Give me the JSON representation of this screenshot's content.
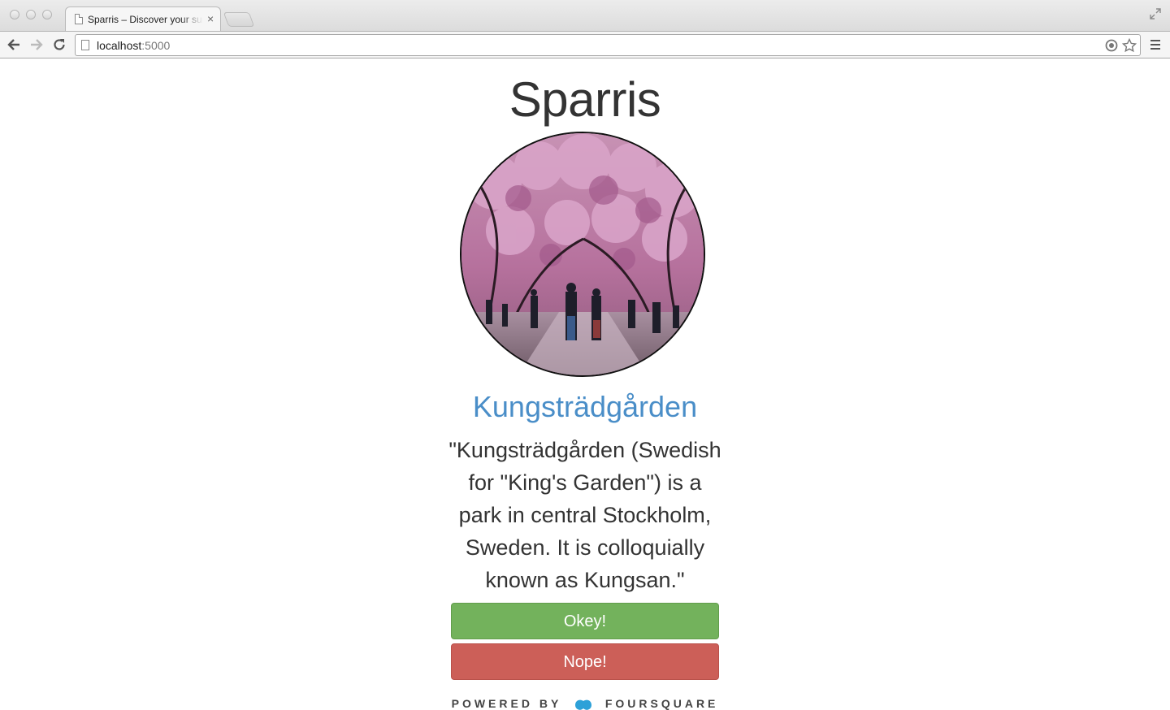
{
  "browser": {
    "tab_title": "Sparris – Discover your sur",
    "tab_close": "×",
    "url_host": "localhost",
    "url_port": ":5000"
  },
  "page": {
    "site_title": "Sparris",
    "place_name": "Kungsträdgården",
    "place_description": "\"Kungsträdgården (Swedish for \"King's Garden\") is a park in central Stockholm, Sweden. It is colloquially known as Kungsan.\"",
    "ok_button": "Okey!",
    "nope_button": "Nope!",
    "powered_by": "POWERED BY",
    "powered_brand": "FOURSQUARE"
  },
  "colors": {
    "accent_title": "#4a8ec8",
    "ok_green": "#73b25c",
    "nope_red": "#cc5f58"
  }
}
